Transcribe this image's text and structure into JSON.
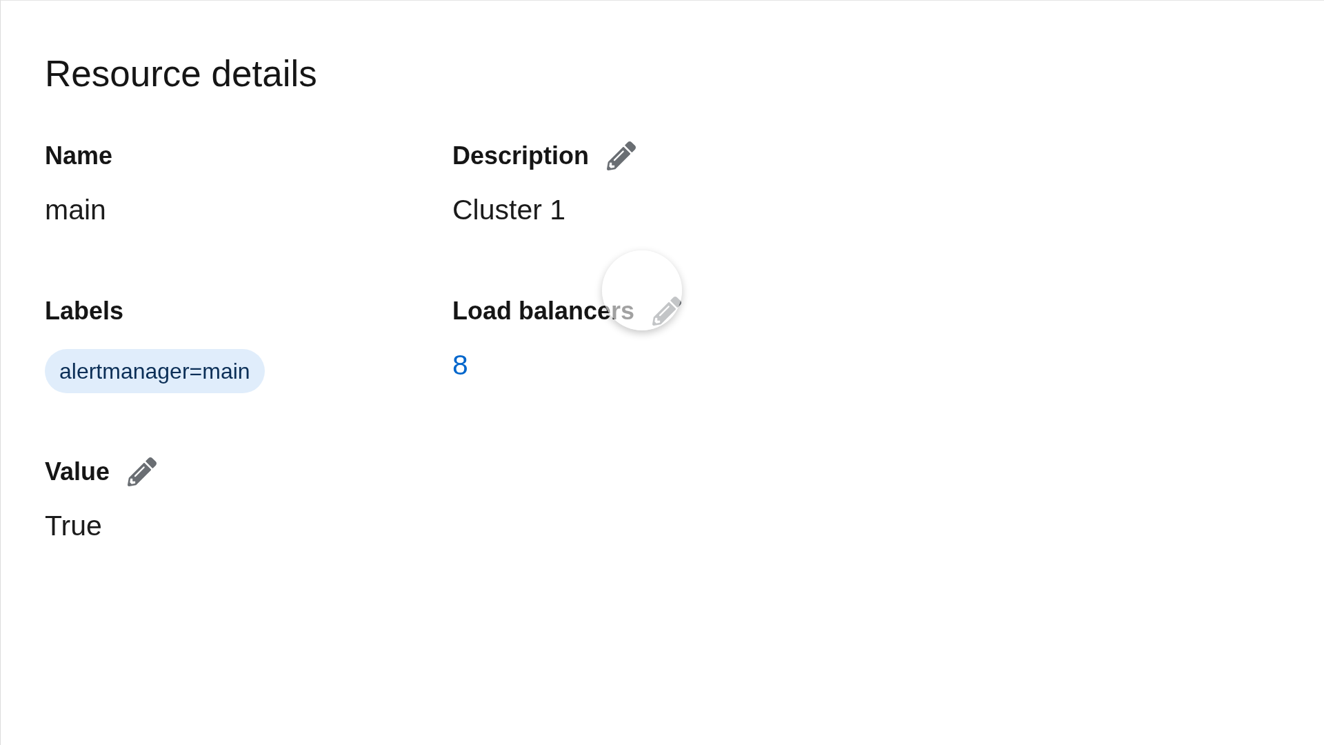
{
  "page": {
    "title": "Resource details"
  },
  "fields": [
    {
      "label": "Name",
      "kind": "text",
      "value": "main",
      "editable": false,
      "hovered": false
    },
    {
      "label": "Description",
      "kind": "text",
      "value": "Cluster 1",
      "editable": true,
      "hovered": false
    },
    {
      "label": "Labels",
      "kind": "labels",
      "labels": [
        "alertmanager=main"
      ],
      "editable": false,
      "hovered": false
    },
    {
      "label": "Load balancers",
      "kind": "link",
      "value": "8",
      "editable": true,
      "hovered": true
    },
    {
      "label": "Value",
      "kind": "text",
      "value": "True",
      "editable": true,
      "hovered": false
    }
  ]
}
